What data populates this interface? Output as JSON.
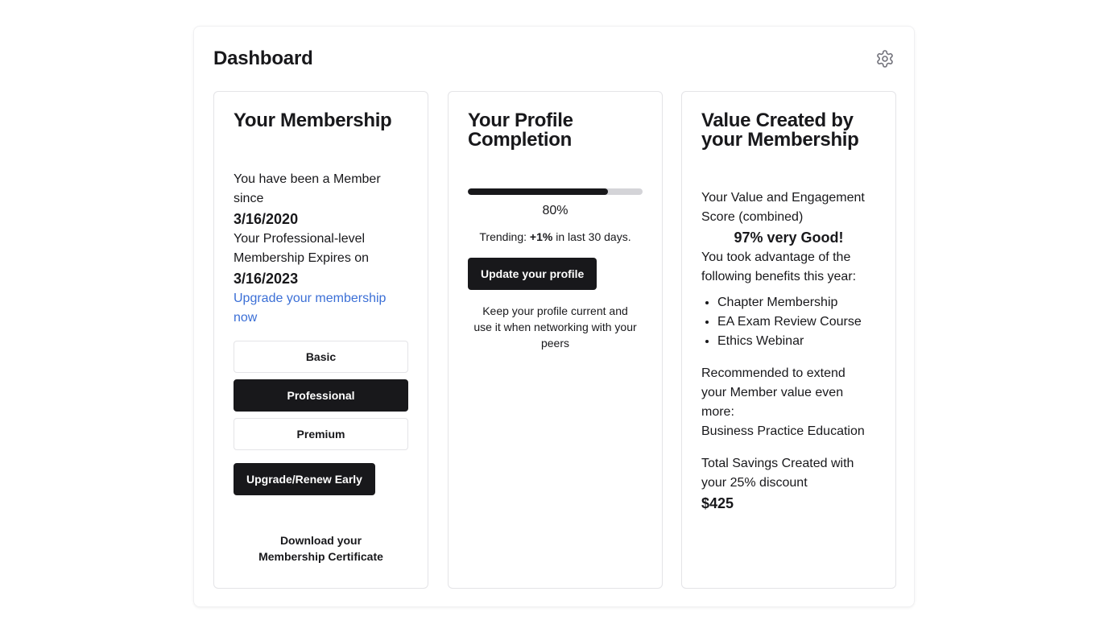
{
  "header": {
    "title": "Dashboard",
    "settings_icon": "gear-icon"
  },
  "membership": {
    "heading": "Your Membership",
    "member_since_label": "You have been a Member since",
    "member_since_date": "3/16/2020",
    "expires_label": "Your Professional-level Membership Expires on",
    "expires_date": "3/16/2023",
    "upgrade_link": "Upgrade your membership now",
    "plans": [
      {
        "label": "Basic",
        "selected": false
      },
      {
        "label": "Professional",
        "selected": true
      },
      {
        "label": "Premium",
        "selected": false
      }
    ],
    "renew_button": "Upgrade/Renew Early",
    "certificate_link": "Download your Membership Certificate"
  },
  "profile": {
    "heading": "Your Profile Completion",
    "progress": 0.8,
    "progress_label": "80%",
    "trending_prefix": "Trending: ",
    "trending_value": "+1%",
    "trending_suffix": " in last 30 days.",
    "update_button": "Update your profile",
    "note": "Keep your profile current and use it when networking with your peers"
  },
  "value": {
    "heading": "Value Created by your Membership",
    "score_label": "Your Value and Engagement Score (combined)",
    "score_value": "97% very Good!",
    "benefits_label": "You took advantage of the following benefits this year:",
    "benefits": [
      "Chapter Membership",
      "EA Exam Review Course",
      "Ethics Webinar"
    ],
    "recommend_label": "Recommended to extend your Member value even more:",
    "recommend_value": "Business Practice Education",
    "savings_label": "Total Savings Created with your 25% discount",
    "savings_value": "$425"
  }
}
